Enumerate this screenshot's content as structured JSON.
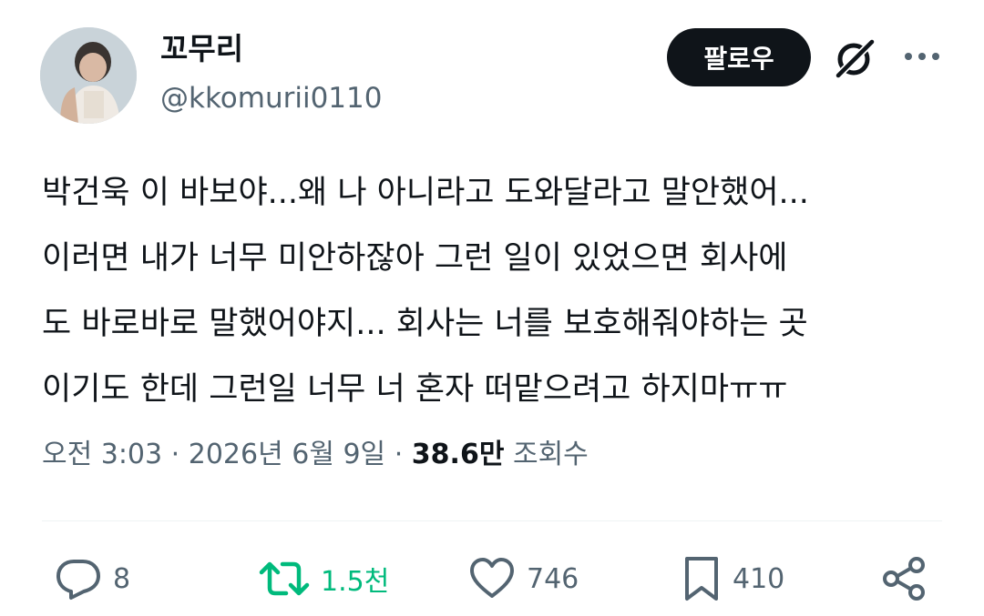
{
  "author": {
    "display_name": "꼬무리",
    "handle": "@kkomurii0110"
  },
  "follow_label": "팔로우",
  "tweet": {
    "lines": [
      "박건욱 이 바보야...왜 나 아니라고 도와달라고 말안했어...",
      "이러면 내가 너무 미안하잖아 그런 일이 있었으면 회사에",
      "도 바로바로 말했어야지... 회사는 너를 보호해줘야하는 곳",
      "이기도 한데 그런일 너무 너 혼자 떠맡으려고 하지마ㅠㅠ"
    ]
  },
  "meta": {
    "time": "오전 3:03",
    "separator": "·",
    "date": "2026년 6월 9일",
    "views_count": "38.6만",
    "views_label": "조회수"
  },
  "actions": {
    "replies": "8",
    "reposts": "1.5천",
    "likes": "746",
    "bookmarks": "410"
  },
  "icons": {
    "grok": "grok-icon",
    "more": "more-icon",
    "reply": "reply-icon",
    "repost": "repost-icon",
    "like": "heart-icon",
    "bookmark": "bookmark-icon",
    "share": "share-icon"
  },
  "colors": {
    "text": "#0f1419",
    "secondary": "#536471",
    "repost_green": "#00ba7c",
    "follow_bg": "#0f1419"
  }
}
